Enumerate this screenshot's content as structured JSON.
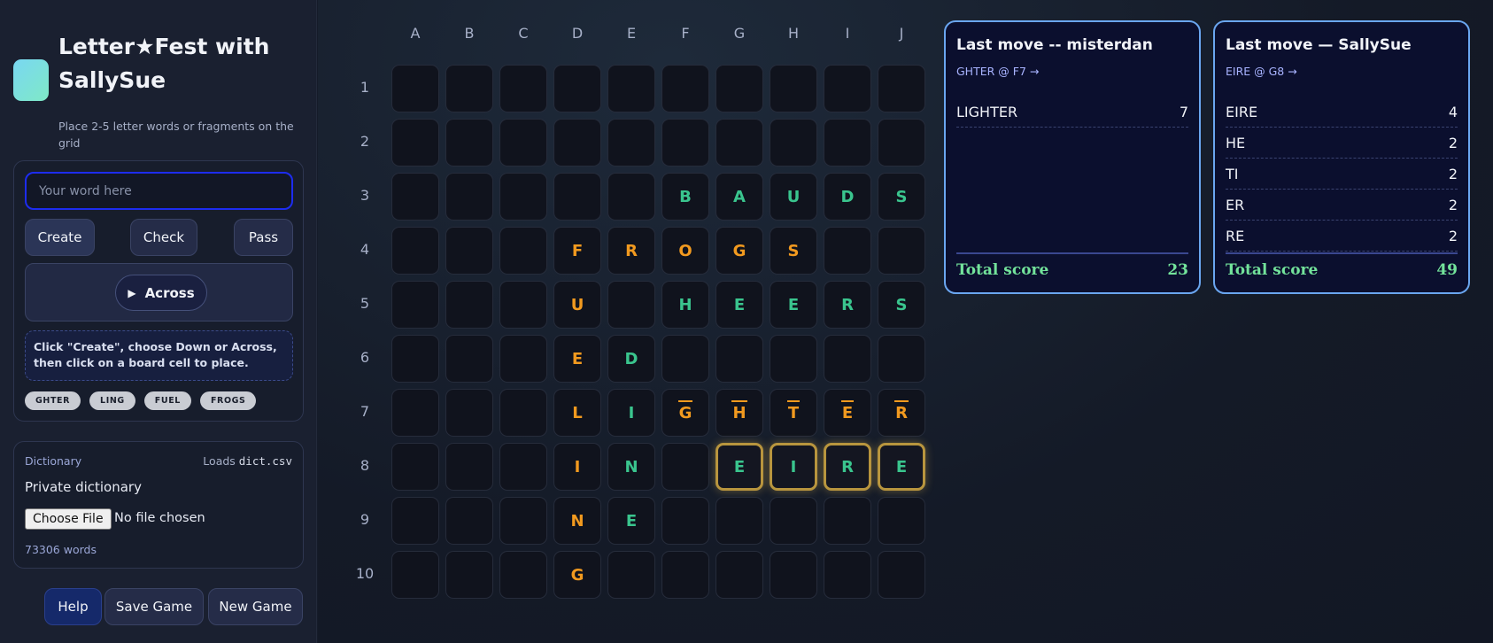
{
  "app": {
    "title": "Letter★Fest with SallySue",
    "subtitle": "Place 2-5 letter words or fragments on the grid"
  },
  "controls": {
    "word_input_placeholder": "Your word here",
    "create_label": "Create",
    "check_label": "Check",
    "pass_label": "Pass",
    "direction_label": "Across",
    "direction_icon": "play-icon",
    "hint": "Click \"Create\", choose Down or Across, then click on a board cell to place.",
    "chips": [
      "GHTER",
      "LING",
      "FUEL",
      "FROGS"
    ]
  },
  "dictionary": {
    "label": "Dictionary",
    "loads_prefix": "Loads",
    "loads_file": "dict.csv",
    "title": "Private dictionary",
    "file_button": "Choose File",
    "file_status": "No file chosen",
    "word_count": "73306 words"
  },
  "footer": {
    "help_label": "Help",
    "save_label": "Save Game",
    "new_label": "New Game"
  },
  "board": {
    "columns": [
      "A",
      "B",
      "C",
      "D",
      "E",
      "F",
      "G",
      "H",
      "I",
      "J"
    ],
    "rows": [
      "1",
      "2",
      "3",
      "4",
      "5",
      "6",
      "7",
      "8",
      "9",
      "10"
    ],
    "colors": {
      "orange": "#f29a1f",
      "green": "#3ac58e",
      "highlight": "#b8953e"
    },
    "tiles": [
      {
        "cell": "F3",
        "letter": "B",
        "color": "green"
      },
      {
        "cell": "G3",
        "letter": "A",
        "color": "green"
      },
      {
        "cell": "H3",
        "letter": "U",
        "color": "green"
      },
      {
        "cell": "I3",
        "letter": "D",
        "color": "green"
      },
      {
        "cell": "J3",
        "letter": "S",
        "color": "green"
      },
      {
        "cell": "D4",
        "letter": "F",
        "color": "orange"
      },
      {
        "cell": "E4",
        "letter": "R",
        "color": "orange"
      },
      {
        "cell": "F4",
        "letter": "O",
        "color": "orange"
      },
      {
        "cell": "G4",
        "letter": "G",
        "color": "orange"
      },
      {
        "cell": "H4",
        "letter": "S",
        "color": "orange"
      },
      {
        "cell": "D5",
        "letter": "U",
        "color": "orange"
      },
      {
        "cell": "F5",
        "letter": "H",
        "color": "green"
      },
      {
        "cell": "G5",
        "letter": "E",
        "color": "green"
      },
      {
        "cell": "H5",
        "letter": "E",
        "color": "green"
      },
      {
        "cell": "I5",
        "letter": "R",
        "color": "green"
      },
      {
        "cell": "J5",
        "letter": "S",
        "color": "green"
      },
      {
        "cell": "D6",
        "letter": "E",
        "color": "orange"
      },
      {
        "cell": "E6",
        "letter": "D",
        "color": "green"
      },
      {
        "cell": "D7",
        "letter": "L",
        "color": "orange"
      },
      {
        "cell": "E7",
        "letter": "I",
        "color": "green"
      },
      {
        "cell": "F7",
        "letter": "G",
        "color": "orange",
        "overline": true
      },
      {
        "cell": "G7",
        "letter": "H",
        "color": "orange",
        "overline": true
      },
      {
        "cell": "H7",
        "letter": "T",
        "color": "orange",
        "overline": true
      },
      {
        "cell": "I7",
        "letter": "E",
        "color": "orange",
        "overline": true
      },
      {
        "cell": "J7",
        "letter": "R",
        "color": "orange",
        "overline": true
      },
      {
        "cell": "D8",
        "letter": "I",
        "color": "orange"
      },
      {
        "cell": "E8",
        "letter": "N",
        "color": "green"
      },
      {
        "cell": "G8",
        "letter": "E",
        "color": "green",
        "highlight": true
      },
      {
        "cell": "H8",
        "letter": "I",
        "color": "green",
        "highlight": true
      },
      {
        "cell": "I8",
        "letter": "R",
        "color": "green",
        "highlight": true
      },
      {
        "cell": "J8",
        "letter": "E",
        "color": "green",
        "highlight": true
      },
      {
        "cell": "D9",
        "letter": "N",
        "color": "orange"
      },
      {
        "cell": "E9",
        "letter": "E",
        "color": "green"
      },
      {
        "cell": "D10",
        "letter": "G",
        "color": "orange"
      }
    ]
  },
  "score_cards": [
    {
      "title": "Last move -- misterdan",
      "move": "GHTER @ F7 →",
      "rows": [
        {
          "word": "LIGHTER",
          "score": "7"
        }
      ],
      "total_label": "Total score",
      "total": "23"
    },
    {
      "title": "Last move — SallySue",
      "move": "EIRE @ G8 →",
      "rows": [
        {
          "word": "EIRE",
          "score": "4"
        },
        {
          "word": "HE",
          "score": "2"
        },
        {
          "word": "TI",
          "score": "2"
        },
        {
          "word": "ER",
          "score": "2"
        },
        {
          "word": "RE",
          "score": "2"
        }
      ],
      "total_label": "Total score",
      "total": "49"
    }
  ]
}
